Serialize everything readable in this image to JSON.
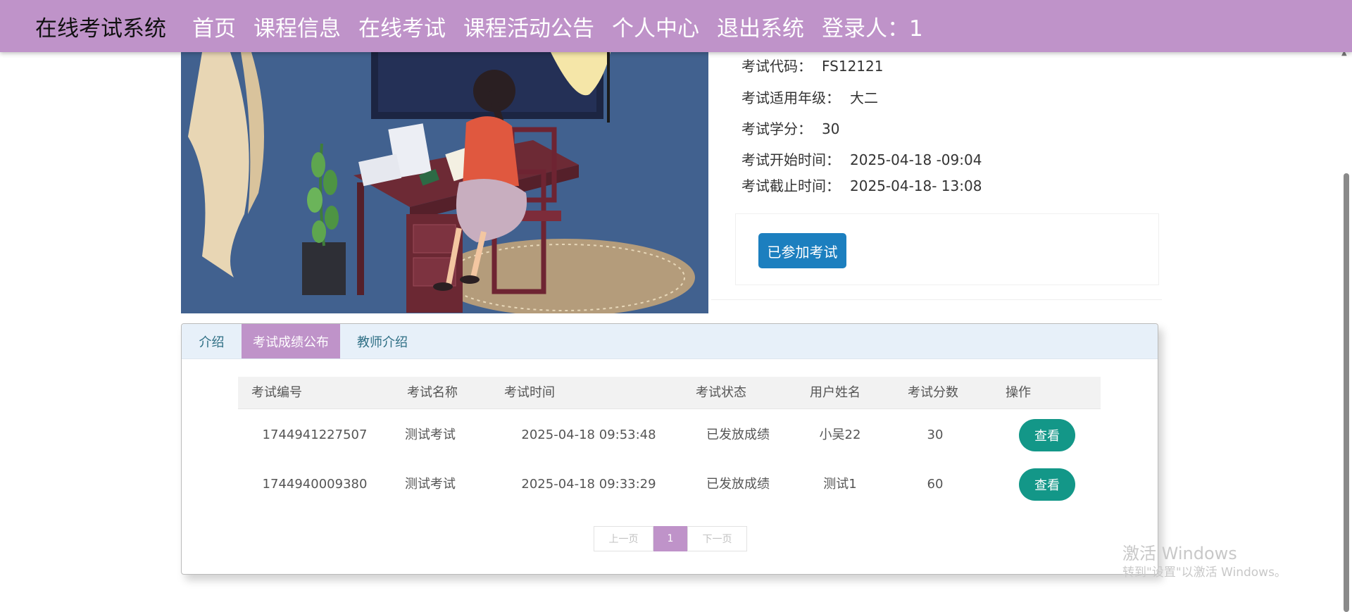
{
  "nav": {
    "brand": "在线考试系统",
    "links": [
      "首页",
      "课程信息",
      "在线考试",
      "课程活动公告",
      "个人中心",
      "退出系统",
      "登录人：1"
    ]
  },
  "exam_info": {
    "code_label": "考试代码：",
    "code_value": "FS12121",
    "grade_label": "考试适用年级：",
    "grade_value": "大二",
    "credit_label": "考试学分：",
    "credit_value": "30",
    "start_label": "考试开始时间：",
    "start_value": "2025-04-18 -09:04",
    "end_label": "考试截止时间：",
    "end_value": "2025-04-18- 13:08",
    "join_button": "已参加考试"
  },
  "tabs": [
    "介绍",
    "考试成绩公布",
    "教师介绍"
  ],
  "table": {
    "headers": [
      "考试编号",
      "考试名称",
      "考试时间",
      "考试状态",
      "用户姓名",
      "考试分数",
      "操作"
    ],
    "rows": [
      {
        "id": "1744941227507",
        "name": "测试考试",
        "time": "2025-04-18 09:53:48",
        "status": "已发放成绩",
        "user": "小吴22",
        "score": "30",
        "action": "查看"
      },
      {
        "id": "1744940009380",
        "name": "测试考试",
        "time": "2025-04-18 09:33:29",
        "status": "已发放成绩",
        "user": "测试1",
        "score": "60",
        "action": "查看"
      }
    ]
  },
  "pager": {
    "prev": "上一页",
    "current": "1",
    "next": "下一页"
  },
  "watermark": {
    "line1": "激活 Windows",
    "line2": "转到\"设置\"以激活 Windows。"
  },
  "colors": {
    "nav_bg": "#bf93c9",
    "accent": "#bf93c9",
    "primary_button": "#1c7fbf",
    "view_button": "#139788"
  }
}
